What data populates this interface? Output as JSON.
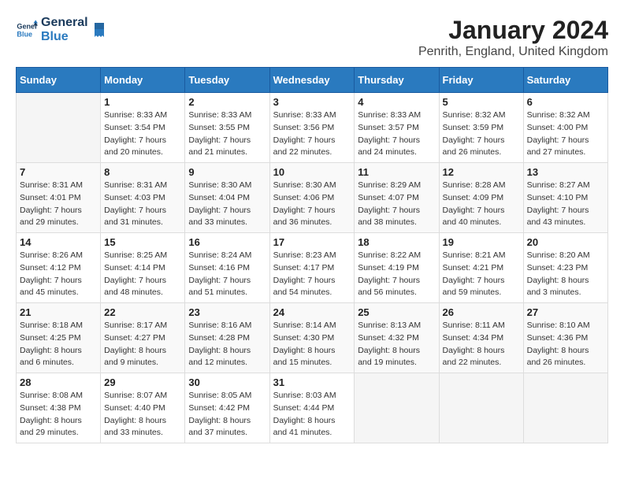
{
  "header": {
    "logo_line1": "General",
    "logo_line2": "Blue",
    "month_title": "January 2024",
    "location": "Penrith, England, United Kingdom"
  },
  "weekdays": [
    "Sunday",
    "Monday",
    "Tuesday",
    "Wednesday",
    "Thursday",
    "Friday",
    "Saturday"
  ],
  "weeks": [
    [
      {
        "day": "",
        "sunrise": "",
        "sunset": "",
        "daylight": ""
      },
      {
        "day": "1",
        "sunrise": "Sunrise: 8:33 AM",
        "sunset": "Sunset: 3:54 PM",
        "daylight": "Daylight: 7 hours and 20 minutes."
      },
      {
        "day": "2",
        "sunrise": "Sunrise: 8:33 AM",
        "sunset": "Sunset: 3:55 PM",
        "daylight": "Daylight: 7 hours and 21 minutes."
      },
      {
        "day": "3",
        "sunrise": "Sunrise: 8:33 AM",
        "sunset": "Sunset: 3:56 PM",
        "daylight": "Daylight: 7 hours and 22 minutes."
      },
      {
        "day": "4",
        "sunrise": "Sunrise: 8:33 AM",
        "sunset": "Sunset: 3:57 PM",
        "daylight": "Daylight: 7 hours and 24 minutes."
      },
      {
        "day": "5",
        "sunrise": "Sunrise: 8:32 AM",
        "sunset": "Sunset: 3:59 PM",
        "daylight": "Daylight: 7 hours and 26 minutes."
      },
      {
        "day": "6",
        "sunrise": "Sunrise: 8:32 AM",
        "sunset": "Sunset: 4:00 PM",
        "daylight": "Daylight: 7 hours and 27 minutes."
      }
    ],
    [
      {
        "day": "7",
        "sunrise": "Sunrise: 8:31 AM",
        "sunset": "Sunset: 4:01 PM",
        "daylight": "Daylight: 7 hours and 29 minutes."
      },
      {
        "day": "8",
        "sunrise": "Sunrise: 8:31 AM",
        "sunset": "Sunset: 4:03 PM",
        "daylight": "Daylight: 7 hours and 31 minutes."
      },
      {
        "day": "9",
        "sunrise": "Sunrise: 8:30 AM",
        "sunset": "Sunset: 4:04 PM",
        "daylight": "Daylight: 7 hours and 33 minutes."
      },
      {
        "day": "10",
        "sunrise": "Sunrise: 8:30 AM",
        "sunset": "Sunset: 4:06 PM",
        "daylight": "Daylight: 7 hours and 36 minutes."
      },
      {
        "day": "11",
        "sunrise": "Sunrise: 8:29 AM",
        "sunset": "Sunset: 4:07 PM",
        "daylight": "Daylight: 7 hours and 38 minutes."
      },
      {
        "day": "12",
        "sunrise": "Sunrise: 8:28 AM",
        "sunset": "Sunset: 4:09 PM",
        "daylight": "Daylight: 7 hours and 40 minutes."
      },
      {
        "day": "13",
        "sunrise": "Sunrise: 8:27 AM",
        "sunset": "Sunset: 4:10 PM",
        "daylight": "Daylight: 7 hours and 43 minutes."
      }
    ],
    [
      {
        "day": "14",
        "sunrise": "Sunrise: 8:26 AM",
        "sunset": "Sunset: 4:12 PM",
        "daylight": "Daylight: 7 hours and 45 minutes."
      },
      {
        "day": "15",
        "sunrise": "Sunrise: 8:25 AM",
        "sunset": "Sunset: 4:14 PM",
        "daylight": "Daylight: 7 hours and 48 minutes."
      },
      {
        "day": "16",
        "sunrise": "Sunrise: 8:24 AM",
        "sunset": "Sunset: 4:16 PM",
        "daylight": "Daylight: 7 hours and 51 minutes."
      },
      {
        "day": "17",
        "sunrise": "Sunrise: 8:23 AM",
        "sunset": "Sunset: 4:17 PM",
        "daylight": "Daylight: 7 hours and 54 minutes."
      },
      {
        "day": "18",
        "sunrise": "Sunrise: 8:22 AM",
        "sunset": "Sunset: 4:19 PM",
        "daylight": "Daylight: 7 hours and 56 minutes."
      },
      {
        "day": "19",
        "sunrise": "Sunrise: 8:21 AM",
        "sunset": "Sunset: 4:21 PM",
        "daylight": "Daylight: 7 hours and 59 minutes."
      },
      {
        "day": "20",
        "sunrise": "Sunrise: 8:20 AM",
        "sunset": "Sunset: 4:23 PM",
        "daylight": "Daylight: 8 hours and 3 minutes."
      }
    ],
    [
      {
        "day": "21",
        "sunrise": "Sunrise: 8:18 AM",
        "sunset": "Sunset: 4:25 PM",
        "daylight": "Daylight: 8 hours and 6 minutes."
      },
      {
        "day": "22",
        "sunrise": "Sunrise: 8:17 AM",
        "sunset": "Sunset: 4:27 PM",
        "daylight": "Daylight: 8 hours and 9 minutes."
      },
      {
        "day": "23",
        "sunrise": "Sunrise: 8:16 AM",
        "sunset": "Sunset: 4:28 PM",
        "daylight": "Daylight: 8 hours and 12 minutes."
      },
      {
        "day": "24",
        "sunrise": "Sunrise: 8:14 AM",
        "sunset": "Sunset: 4:30 PM",
        "daylight": "Daylight: 8 hours and 15 minutes."
      },
      {
        "day": "25",
        "sunrise": "Sunrise: 8:13 AM",
        "sunset": "Sunset: 4:32 PM",
        "daylight": "Daylight: 8 hours and 19 minutes."
      },
      {
        "day": "26",
        "sunrise": "Sunrise: 8:11 AM",
        "sunset": "Sunset: 4:34 PM",
        "daylight": "Daylight: 8 hours and 22 minutes."
      },
      {
        "day": "27",
        "sunrise": "Sunrise: 8:10 AM",
        "sunset": "Sunset: 4:36 PM",
        "daylight": "Daylight: 8 hours and 26 minutes."
      }
    ],
    [
      {
        "day": "28",
        "sunrise": "Sunrise: 8:08 AM",
        "sunset": "Sunset: 4:38 PM",
        "daylight": "Daylight: 8 hours and 29 minutes."
      },
      {
        "day": "29",
        "sunrise": "Sunrise: 8:07 AM",
        "sunset": "Sunset: 4:40 PM",
        "daylight": "Daylight: 8 hours and 33 minutes."
      },
      {
        "day": "30",
        "sunrise": "Sunrise: 8:05 AM",
        "sunset": "Sunset: 4:42 PM",
        "daylight": "Daylight: 8 hours and 37 minutes."
      },
      {
        "day": "31",
        "sunrise": "Sunrise: 8:03 AM",
        "sunset": "Sunset: 4:44 PM",
        "daylight": "Daylight: 8 hours and 41 minutes."
      },
      {
        "day": "",
        "sunrise": "",
        "sunset": "",
        "daylight": ""
      },
      {
        "day": "",
        "sunrise": "",
        "sunset": "",
        "daylight": ""
      },
      {
        "day": "",
        "sunrise": "",
        "sunset": "",
        "daylight": ""
      }
    ]
  ]
}
